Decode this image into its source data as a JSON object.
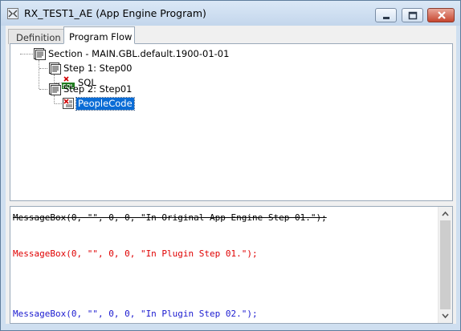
{
  "window": {
    "title": "RX_TEST1_AE (App Engine Program)"
  },
  "tabs": [
    {
      "label": "Definition",
      "active": false
    },
    {
      "label": "Program Flow",
      "active": true
    }
  ],
  "tree": {
    "section": "Section - MAIN.GBL.default.1900-01-01",
    "steps": [
      {
        "label": "Step 1: Step00",
        "action": "SQL"
      },
      {
        "label": "Step 2: Step01",
        "action": "PeopleCode",
        "selected": true
      }
    ]
  },
  "code": {
    "lines": [
      {
        "text": "MessageBox(0, \"\", 0, 0, \"In Original App Engine Step 01.\");",
        "color": "#000000",
        "strike": true
      },
      {
        "text": "MessageBox(0, \"\", 0, 0, \"In Plugin Step 01.\");",
        "color": "#e00000",
        "strike": false
      },
      {
        "text": "MessageBox(0, \"\", 0, 0, \"In Plugin Step 02.\");",
        "color": "#1a1ad0",
        "strike": false
      }
    ]
  },
  "colors": {
    "selection": "#0a6cd6",
    "close_button": "#c7462f",
    "added_code": "#1a1ad0",
    "plugin_code": "#e00000"
  }
}
